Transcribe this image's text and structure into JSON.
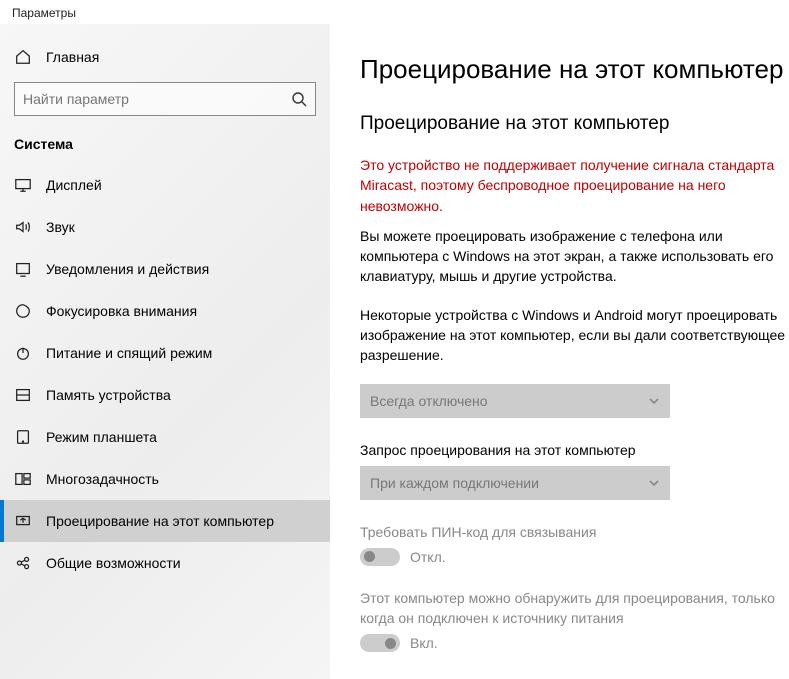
{
  "window": {
    "title": "Параметры"
  },
  "home": {
    "label": "Главная"
  },
  "search": {
    "placeholder": "Найти параметр"
  },
  "section": {
    "label": "Система"
  },
  "nav": [
    {
      "id": "display",
      "label": "Дисплей"
    },
    {
      "id": "sound",
      "label": "Звук"
    },
    {
      "id": "notifications",
      "label": "Уведомления и действия"
    },
    {
      "id": "focus",
      "label": "Фокусировка внимания"
    },
    {
      "id": "power",
      "label": "Питание и спящий режим"
    },
    {
      "id": "storage",
      "label": "Память устройства"
    },
    {
      "id": "tablet",
      "label": "Режим планшета"
    },
    {
      "id": "multitask",
      "label": "Многозадачность"
    },
    {
      "id": "projecting",
      "label": "Проецирование на этот компьютер",
      "active": true
    },
    {
      "id": "shared",
      "label": "Общие возможности"
    }
  ],
  "page": {
    "title": "Проецирование на этот компьютер",
    "subtitle": "Проецирование на этот компьютер",
    "error": "Это устройство не поддерживает получение сигнала стандарта Miracast, поэтому беспроводное проецирование на него невозможно.",
    "desc1": "Вы можете проецировать изображение с телефона или компьютера с Windows на этот экран, а также использовать его клавиатуру, мышь и другие устройства.",
    "desc2": "Некоторые устройства с Windows и Android могут проецировать изображение на этот компьютер, если вы дали соответствующее разрешение.",
    "select1": {
      "value": "Всегда отключено"
    },
    "field2_label": "Запрос проецирования на этот компьютер",
    "select2": {
      "value": "При каждом подключении"
    },
    "pin_label": "Требовать ПИН-код для связывания",
    "pin_state": "Откл.",
    "discover_label": "Этот компьютер можно обнаружить для проецирования, только когда он подключен к источнику питания",
    "discover_state": "Вкл."
  }
}
